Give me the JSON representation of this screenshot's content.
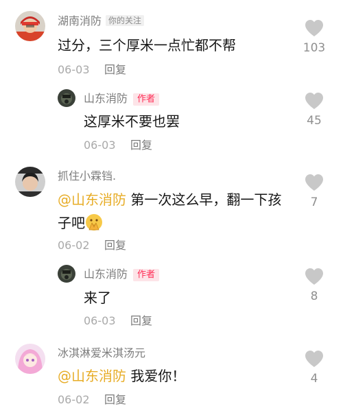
{
  "comments": [
    {
      "username": "湖南消防",
      "tag": "你的关注",
      "text": "过分，三个厚米一点忙都不帮",
      "date": "06-03",
      "reply_label": "回复",
      "likes": "103"
    },
    {
      "username": "山东消防",
      "tag": "作者",
      "text": "这厚米不要也罢",
      "date": "06-03",
      "reply_label": "回复",
      "likes": "45"
    },
    {
      "username": "抓住小霖铛.",
      "mention": "@山东消防",
      "text_line1": " 第一次这么早，翻一下孩",
      "text_line2": "子吧",
      "emoji": "hands-praying-emoji",
      "date": "06-02",
      "reply_label": "回复",
      "likes": "7"
    },
    {
      "username": "山东消防",
      "tag": "作者",
      "text": "来了",
      "date": "06-03",
      "reply_label": "回复",
      "likes": "8"
    },
    {
      "username": "冰淇淋爱米淇汤元",
      "mention": "@山东消防",
      "text": " 我爱你！",
      "date": "06-02",
      "reply_label": "回复",
      "likes": "4"
    }
  ],
  "colors": {
    "mention": "#e7ac26",
    "author_tag": "#fe2c55",
    "heart": "#c8c8c8"
  },
  "icons": {
    "like": "heart-icon"
  }
}
